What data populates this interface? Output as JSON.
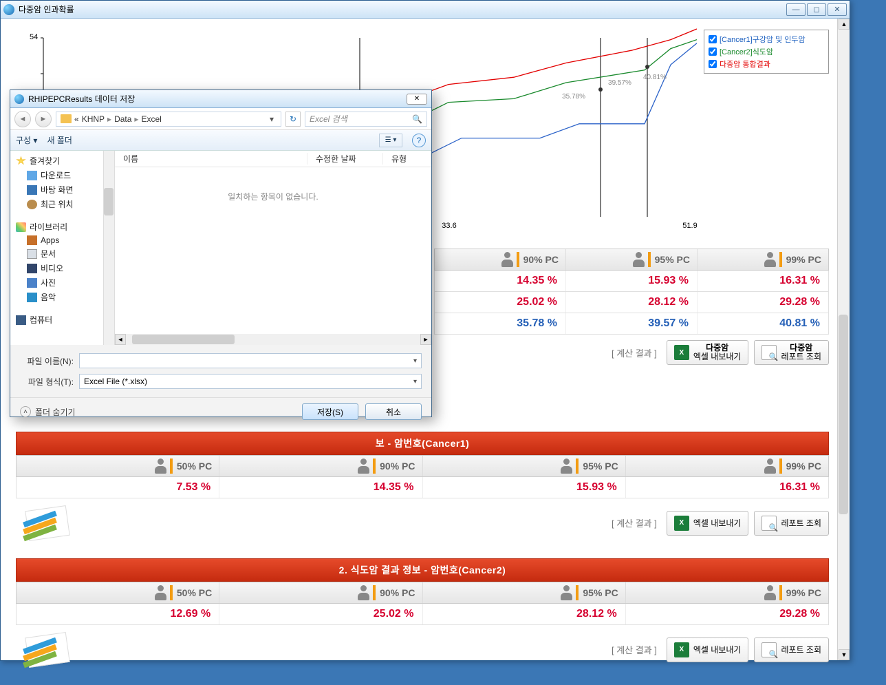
{
  "window": {
    "title": "다중암 인과확률"
  },
  "legend": {
    "items": [
      {
        "label": "[Cancer1]구강암 및 인두암",
        "color": "blue"
      },
      {
        "label": "[Cancer2]식도암",
        "color": "green"
      },
      {
        "label": "다중암 통합결과",
        "color": "red"
      }
    ]
  },
  "chart_data": {
    "type": "line",
    "xlabel": "",
    "ylabel": "",
    "y_axis_top_label": "54",
    "x_ticks": [
      "33.6",
      "51.9"
    ],
    "annotations": [
      "35.78%",
      "39.57%",
      "40.81%"
    ],
    "series": [
      {
        "name": "[Cancer1]구강암 및 인두암",
        "color": "#2c63c9",
        "points": [
          [
            0,
            0.35
          ],
          [
            0.59,
            0.35
          ],
          [
            0.64,
            0.44
          ],
          [
            0.76,
            0.44
          ],
          [
            0.82,
            0.52
          ],
          [
            0.92,
            0.52
          ],
          [
            0.96,
            0.85
          ],
          [
            1.0,
            0.97
          ]
        ]
      },
      {
        "name": "[Cancer2]식도암",
        "color": "#1a8a2d",
        "points": [
          [
            0,
            0.52
          ],
          [
            0.57,
            0.55
          ],
          [
            0.62,
            0.64
          ],
          [
            0.72,
            0.66
          ],
          [
            0.8,
            0.75
          ],
          [
            0.92,
            0.82
          ],
          [
            0.96,
            0.94
          ],
          [
            1.0,
            0.99
          ]
        ]
      },
      {
        "name": "다중암 통합결과",
        "color": "#e30000",
        "points": [
          [
            0,
            0.62
          ],
          [
            0.56,
            0.66
          ],
          [
            0.62,
            0.74
          ],
          [
            0.72,
            0.78
          ],
          [
            0.8,
            0.86
          ],
          [
            0.9,
            0.93
          ],
          [
            0.96,
            0.99
          ],
          [
            1.0,
            1.05
          ]
        ]
      }
    ],
    "vlines_x": [
      0.86,
      0.93
    ]
  },
  "top_table": {
    "headers": [
      "90% PC",
      "95% PC",
      "99% PC"
    ],
    "rows": [
      {
        "cls": "v-red",
        "vals": [
          "14.35 %",
          "15.93 %",
          "16.31 %"
        ]
      },
      {
        "cls": "v-red",
        "vals": [
          "25.02 %",
          "28.12 %",
          "29.28 %"
        ]
      },
      {
        "cls": "v-blue",
        "vals": [
          "35.78 %",
          "39.57 %",
          "40.81 %"
        ]
      }
    ]
  },
  "calc_label": "[ 계산 결과 ]",
  "buttons": {
    "excel_two": {
      "line1": "다중암",
      "line2": "엑셀 내보내기"
    },
    "report_two": {
      "line1": "다중암",
      "line2": "레포트 조회"
    },
    "excel_one": "엑셀 내보내기",
    "report_one": "레포트 조회"
  },
  "sections": [
    {
      "title": "보 - 암번호(Cancer1)",
      "headers": [
        "50% PC",
        "90% PC",
        "95% PC",
        "99% PC"
      ],
      "vals": [
        "7.53 %",
        "14.35 %",
        "15.93 %",
        "16.31 %"
      ]
    },
    {
      "title": "2. 식도암 결과 정보 - 암번호(Cancer2)",
      "headers": [
        "50% PC",
        "90% PC",
        "95% PC",
        "99% PC"
      ],
      "vals": [
        "12.69 %",
        "25.02 %",
        "28.12 %",
        "29.28 %"
      ]
    }
  ],
  "dialog": {
    "title": "RHIPEPCResults 데이터 저장",
    "crumb": [
      "KHNP",
      "Data",
      "Excel"
    ],
    "crumb_prefix": "«",
    "search_placeholder": "Excel 검색",
    "toolbar": {
      "organize": "구성 ▾",
      "new_folder": "새 폴더"
    },
    "tree": {
      "fav": "즐겨찾기",
      "download": "다운로드",
      "desktop": "바탕 화면",
      "recent": "최근 위치",
      "library": "라이브러리",
      "apps": "Apps",
      "docs": "문서",
      "video": "비디오",
      "photo": "사진",
      "music": "음악",
      "computer": "컴퓨터"
    },
    "columns": {
      "name": "이름",
      "modified": "수정한 날짜",
      "type": "유형"
    },
    "empty": "일치하는 항목이 없습니다.",
    "filename_label": "파일 이름(N):",
    "filetype_label": "파일 형식(T):",
    "filetype_value": "Excel File (*.xlsx)",
    "hide_folders": "폴더 숨기기",
    "save": "저장(S)",
    "cancel": "취소"
  }
}
